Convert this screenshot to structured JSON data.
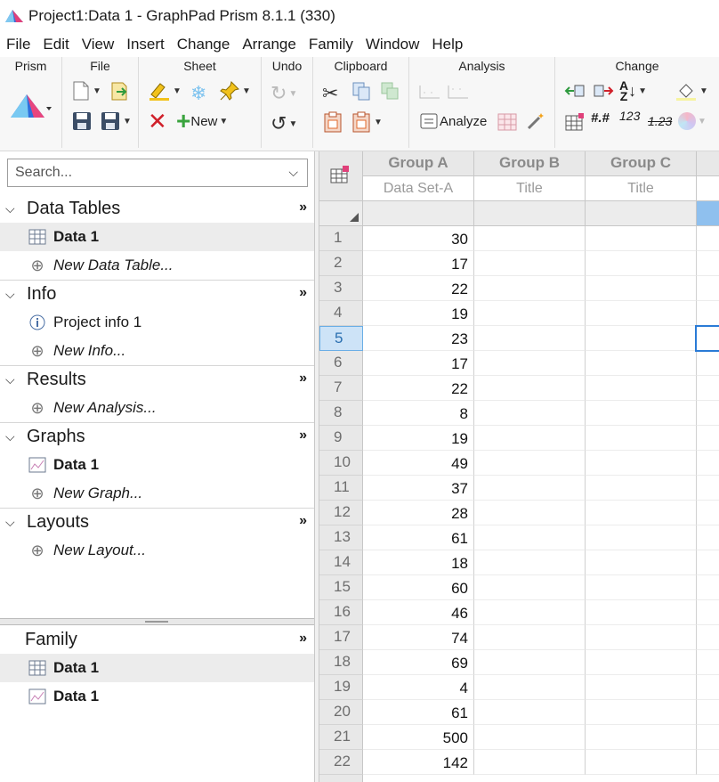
{
  "title": "Project1:Data 1 - GraphPad Prism 8.1.1 (330)",
  "menu": [
    "File",
    "Edit",
    "View",
    "Insert",
    "Change",
    "Arrange",
    "Family",
    "Window",
    "Help"
  ],
  "ribbon": {
    "groups": [
      "Prism",
      "File",
      "Sheet",
      "Undo",
      "Clipboard",
      "Analysis",
      "Change"
    ],
    "new_label": "New",
    "analyze_label": "Analyze",
    "num_label": "123",
    "num_label2": "1.23",
    "fmt_label": "#.#"
  },
  "navigator": {
    "search_placeholder": "Search...",
    "sections": [
      {
        "title": "Data Tables",
        "items": [
          {
            "label": "Data 1"
          },
          {
            "label": "New Data Table..."
          }
        ]
      },
      {
        "title": "Info",
        "items": [
          {
            "label": "Project info 1"
          },
          {
            "label": "New Info..."
          }
        ]
      },
      {
        "title": "Results",
        "items": [
          {
            "label": "New Analysis..."
          }
        ]
      },
      {
        "title": "Graphs",
        "items": [
          {
            "label": "Data 1"
          },
          {
            "label": "New Graph..."
          }
        ]
      },
      {
        "title": "Layouts",
        "items": [
          {
            "label": "New Layout..."
          }
        ]
      }
    ],
    "family": {
      "title": "Family",
      "items": [
        {
          "label": "Data 1"
        },
        {
          "label": "Data 1"
        }
      ]
    },
    "collapse_glyph": "»"
  },
  "sheet": {
    "columns": [
      {
        "header": "Group A",
        "subtitle": "Data Set-A"
      },
      {
        "header": "Group B",
        "subtitle": "Title"
      },
      {
        "header": "Group C",
        "subtitle": "Title"
      }
    ],
    "rows": [
      "1",
      "2",
      "3",
      "4",
      "5",
      "6",
      "7",
      "8",
      "9",
      "10",
      "11",
      "12",
      "13",
      "14",
      "15",
      "16",
      "17",
      "18",
      "19",
      "20",
      "21",
      "22"
    ],
    "values_a": [
      "30",
      "17",
      "22",
      "19",
      "23",
      "17",
      "22",
      "8",
      "19",
      "49",
      "37",
      "28",
      "61",
      "18",
      "60",
      "46",
      "74",
      "69",
      "4",
      "61",
      "500",
      "142"
    ],
    "selected_row": "5"
  },
  "colors": {
    "accent": "#2a7bd6",
    "selected_row_bg": "#cde3f7",
    "header_bg": "#e8e8e8"
  }
}
